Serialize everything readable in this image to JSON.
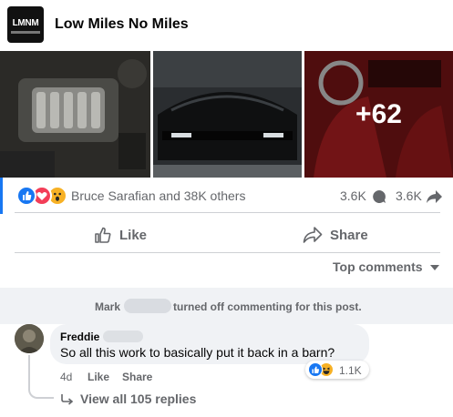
{
  "post": {
    "page_logo_text": "LMNM",
    "page_name": "Low Miles No Miles",
    "photos": [
      {
        "icon": "engine-bay-photo"
      },
      {
        "icon": "car-front-photo"
      },
      {
        "icon": "red-interior-photo",
        "more_label": "+62"
      }
    ],
    "reactions": {
      "icons": [
        "like-reaction",
        "love-reaction",
        "wow-reaction"
      ],
      "summary": "Bruce Sarafian and 38K others",
      "comments_count": "3.6K",
      "shares_count": "3.6K"
    },
    "actions": {
      "like_label": "Like",
      "share_label": "Share"
    },
    "sort_label": "Top comments"
  },
  "notice": {
    "name": "Mark",
    "text": "turned off commenting for this post."
  },
  "comment": {
    "author": "Freddie",
    "text": "So all this work to basically put it back in a barn?",
    "time": "4d",
    "like_label": "Like",
    "share_label": "Share",
    "reaction_count": "1.1K",
    "reaction_icons": [
      "like-reaction",
      "haha-reaction"
    ],
    "view_replies": "View all 105 replies"
  },
  "colors": {
    "accent": "#1877f2",
    "text_secondary": "#65676b",
    "divider": "#ced0d4",
    "notice_bg": "#f0f2f5"
  }
}
